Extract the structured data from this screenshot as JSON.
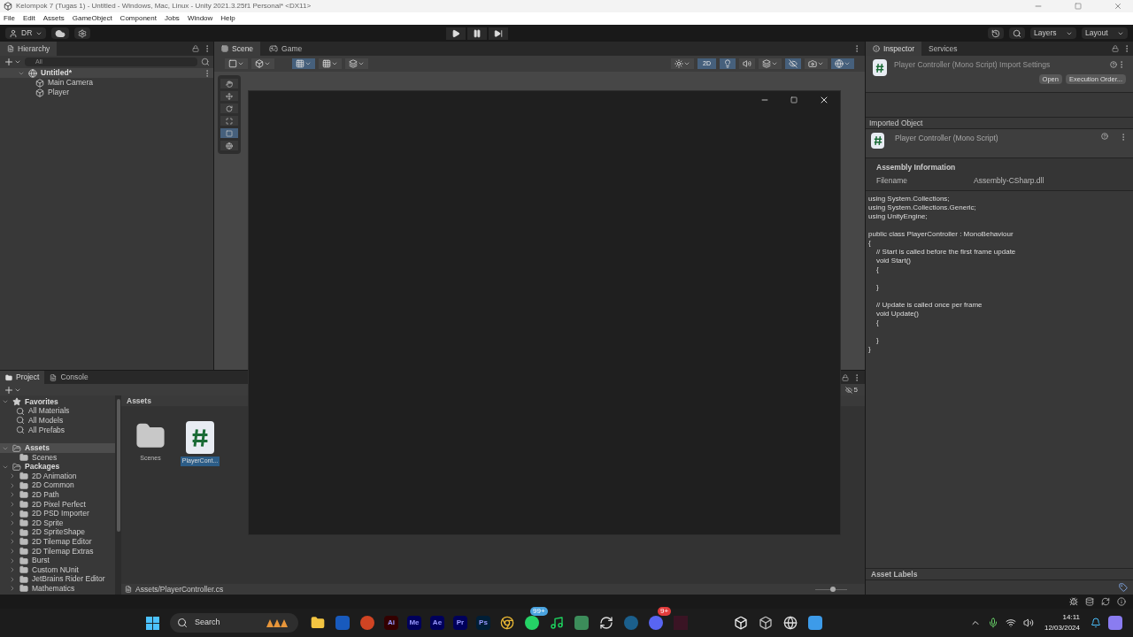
{
  "title_bar": {
    "title": "Kelompok 7 (Tugas 1) - Untitled - Windows, Mac, Linux - Unity 2021.3.25f1 Personal* <DX11>"
  },
  "menu": [
    "File",
    "Edit",
    "Assets",
    "GameObject",
    "Component",
    "Jobs",
    "Window",
    "Help"
  ],
  "toolbar": {
    "account": "DR",
    "layers": "Layers",
    "layout": "Layout"
  },
  "hierarchy": {
    "tab": "Hierarchy",
    "search_placeholder": "All",
    "scene": {
      "name": "Untitled*",
      "expanded": true,
      "children": [
        {
          "name": "Main Camera"
        },
        {
          "name": "Player"
        }
      ]
    }
  },
  "scene_view": {
    "tabs": [
      {
        "label": "Scene",
        "selected": true
      },
      {
        "label": "Game",
        "selected": false
      }
    ],
    "mode_2d": {
      "label": "2D",
      "on": true
    }
  },
  "inspector": {
    "tabs": [
      {
        "label": "Inspector",
        "selected": true
      },
      {
        "label": "Services",
        "selected": false
      }
    ],
    "header": "Player Controller (Mono Script) Import Settings",
    "buttons": [
      "Open",
      "Execution Order..."
    ],
    "section": "Imported Object",
    "object_title": "Player Controller (Mono Script)",
    "assembly": {
      "heading": "Assembly Information",
      "label": "Filename",
      "value": "Assembly-CSharp.dll"
    },
    "code": "using System.Collections;\nusing System.Collections.Generic;\nusing UnityEngine;\n\npublic class PlayerController : MonoBehaviour\n{\n    // Start is called before the first frame update\n    void Start()\n    {\n\n    }\n\n    // Update is called once per frame\n    void Update()\n    {\n\n    }\n}",
    "asset_labels": "Asset Labels"
  },
  "project": {
    "tabs": [
      {
        "label": "Project",
        "selected": true
      },
      {
        "label": "Console",
        "selected": false
      }
    ],
    "tree": [
      {
        "label": "Favorites",
        "kind": "favorites",
        "expanded": true,
        "selected": false,
        "children": [
          {
            "label": "All Materials"
          },
          {
            "label": "All Models"
          },
          {
            "label": "All Prefabs"
          }
        ]
      },
      {
        "label": "Assets",
        "kind": "folder",
        "expanded": true,
        "selected": true,
        "children": [
          {
            "label": "Scenes"
          }
        ]
      },
      {
        "label": "Packages",
        "kind": "packages",
        "expanded": true,
        "selected": false,
        "children": [
          {
            "label": "2D Animation"
          },
          {
            "label": "2D Common"
          },
          {
            "label": "2D Path"
          },
          {
            "label": "2D Pixel Perfect"
          },
          {
            "label": "2D PSD Importer"
          },
          {
            "label": "2D Sprite"
          },
          {
            "label": "2D SpriteShape"
          },
          {
            "label": "2D Tilemap Editor"
          },
          {
            "label": "2D Tilemap Extras"
          },
          {
            "label": "Burst"
          },
          {
            "label": "Custom NUnit"
          },
          {
            "label": "JetBrains Rider Editor"
          },
          {
            "label": "Mathematics"
          }
        ]
      }
    ],
    "breadcrumb": "Assets",
    "hidden_count": "5",
    "items": [
      {
        "label": "Scenes",
        "kind": "folder",
        "selected": false
      },
      {
        "label": "PlayerCont...",
        "kind": "script",
        "selected": true
      }
    ],
    "path": "Assets/PlayerController.cs",
    "zoom": {
      "level": 0.55
    }
  },
  "taskbar": {
    "search": "Search",
    "apps": [
      {
        "label": "Ai",
        "color": "#330000"
      },
      {
        "label": "Me",
        "color": "#00005b"
      },
      {
        "label": "Ae",
        "color": "#00005b"
      },
      {
        "label": "Pr",
        "color": "#00005b"
      },
      {
        "label": "Ps",
        "color": "#001e36"
      }
    ],
    "badges": [
      "99+",
      "9+"
    ],
    "time": "14:11",
    "date": "12/03/2024"
  }
}
